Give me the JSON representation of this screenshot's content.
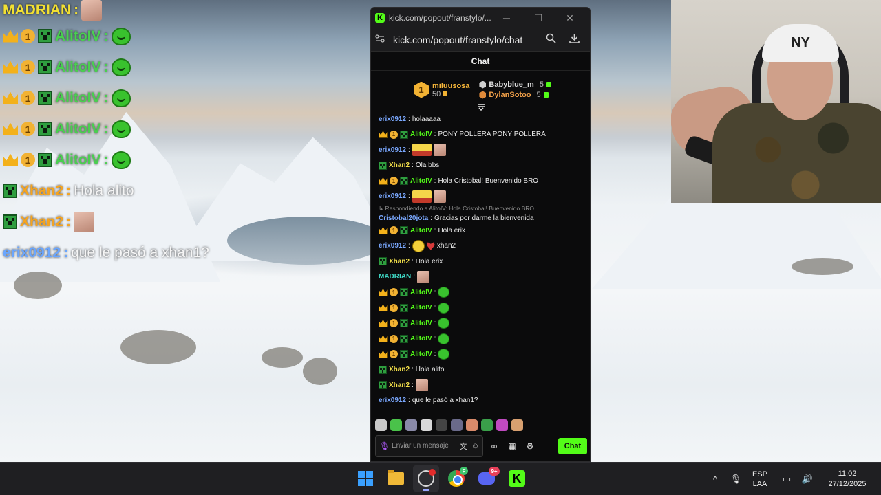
{
  "overlay": {
    "rows": [
      {
        "kind": "face",
        "name": "MADRIAN",
        "sep": ":",
        "name_color": "yellow",
        "text": ""
      },
      {
        "kind": "blob",
        "name": "AlitoIV",
        "sep": ":",
        "name_color": "green",
        "text": ""
      },
      {
        "kind": "blob",
        "name": "AlitoIV",
        "sep": ":",
        "name_color": "green",
        "text": ""
      },
      {
        "kind": "blob",
        "name": "AlitoIV",
        "sep": ":",
        "name_color": "green",
        "text": ""
      },
      {
        "kind": "blob",
        "name": "AlitoIV",
        "sep": ":",
        "name_color": "green",
        "text": ""
      },
      {
        "kind": "blob",
        "name": "AlitoIV",
        "sep": ":",
        "name_color": "green",
        "text": ""
      },
      {
        "kind": "text",
        "name": "Xhan2",
        "sep": ":",
        "name_color": "orange",
        "text": "Hola alito"
      },
      {
        "kind": "face",
        "name": "Xhan2",
        "sep": ":",
        "name_color": "orange",
        "text": ""
      },
      {
        "kind": "text",
        "name": "erix0912",
        "sep": ":",
        "name_color": "blue",
        "text": "que le pasó a xhan1?"
      }
    ]
  },
  "webcam": {
    "cap_text": "NY"
  },
  "browser": {
    "tab_title": "kick.com/popout/franstylo/...",
    "url": "kick.com/popout/franstylo/chat",
    "favicon_letter": "K",
    "min_glyph": "─",
    "max_glyph": "☐",
    "close_glyph": "✕"
  },
  "chat": {
    "header": "Chat",
    "top_gifter": {
      "rank": "1",
      "name": "miluusosa",
      "count": "50"
    },
    "gifters": [
      {
        "name": "Babyblue_m",
        "count": "5",
        "color": "#d9d9d9"
      },
      {
        "name": "DylanSotoo",
        "count": "5",
        "color": "#f6a34a"
      }
    ],
    "messages": [
      {
        "user": "erix0912",
        "color": "blue",
        "badges": [],
        "text": "holaaaaa",
        "emotes": []
      },
      {
        "user": "AlitoIV",
        "color": "green",
        "badges": [
          "crown",
          "coin",
          "creeper"
        ],
        "text": "PONY POLLERA PONY POLLERA",
        "emotes": []
      },
      {
        "user": "erix0912",
        "color": "blue",
        "badges": [],
        "text": "",
        "emotes": [
          "sign",
          "face"
        ]
      },
      {
        "user": "Xhan2",
        "color": "yellow",
        "badges": [
          "creeper"
        ],
        "text": "Ola bbs",
        "emotes": []
      },
      {
        "user": "AlitoIV",
        "color": "green",
        "badges": [
          "crown",
          "coin",
          "creeper"
        ],
        "text": "Hola Cristobal! Buenvenido BRO",
        "emotes": []
      },
      {
        "user": "erix0912",
        "color": "blue",
        "badges": [],
        "text": "",
        "emotes": [
          "sign",
          "face"
        ]
      },
      {
        "user": "Cristobal20jota",
        "color": "blue",
        "badges": [],
        "text": "Gracias por darme la bienvenida",
        "emotes": [],
        "reply": "↳ Respondiendo a AlitoIV: Hola Cristobal! Buenvenido BRO"
      },
      {
        "user": "AlitoIV",
        "color": "green",
        "badges": [
          "crown",
          "coin",
          "creeper"
        ],
        "text": "Hola erix",
        "emotes": []
      },
      {
        "user": "erix0912",
        "color": "blue",
        "badges": [],
        "text": "xhan2",
        "emotes": [
          "smiley",
          "heart"
        ]
      },
      {
        "user": "Xhan2",
        "color": "yellow",
        "badges": [
          "creeper"
        ],
        "text": "Hola erix",
        "emotes": []
      },
      {
        "user": "MADRIAN",
        "color": "teal",
        "badges": [],
        "text": "",
        "emotes": [
          "face"
        ]
      },
      {
        "user": "AlitoIV",
        "color": "green",
        "badges": [
          "crown",
          "coin",
          "creeper"
        ],
        "text": "",
        "emotes": [
          "blob"
        ]
      },
      {
        "user": "AlitoIV",
        "color": "green",
        "badges": [
          "crown",
          "coin",
          "creeper"
        ],
        "text": "",
        "emotes": [
          "blob"
        ]
      },
      {
        "user": "AlitoIV",
        "color": "green",
        "badges": [
          "crown",
          "coin",
          "creeper"
        ],
        "text": "",
        "emotes": [
          "blob"
        ]
      },
      {
        "user": "AlitoIV",
        "color": "green",
        "badges": [
          "crown",
          "coin",
          "creeper"
        ],
        "text": "",
        "emotes": [
          "blob"
        ]
      },
      {
        "user": "AlitoIV",
        "color": "green",
        "badges": [
          "crown",
          "coin",
          "creeper"
        ],
        "text": "",
        "emotes": [
          "blob"
        ]
      },
      {
        "user": "Xhan2",
        "color": "yellow",
        "badges": [
          "creeper"
        ],
        "text": "Hola alito",
        "emotes": []
      },
      {
        "user": "Xhan2",
        "color": "yellow",
        "badges": [
          "creeper"
        ],
        "text": "",
        "emotes": [
          "face"
        ]
      },
      {
        "user": "erix0912",
        "color": "blue",
        "badges": [],
        "text": "que le pasó a xhan1?",
        "emotes": []
      }
    ],
    "emote_strip_colors": [
      "#c9c9c9",
      "#4ac24a",
      "#8a8aa8",
      "#d8d8d8",
      "#444444",
      "#6a6a8a",
      "#d98a6a",
      "#3aa04a",
      "#c04ac0",
      "#d8a070"
    ],
    "compose": {
      "placeholder": "Enviar un mensaje",
      "send_label": "Chat",
      "mic_glyph": "🎙",
      "translate_glyph": "文",
      "emoji_glyph": "☺",
      "points_glyph": "∞",
      "store_glyph": "▦",
      "settings_glyph": "⚙"
    }
  },
  "taskbar": {
    "chrome_profile": "F",
    "discord_badge": "9+",
    "kick_letter": "K",
    "chevron_glyph": "^",
    "mic_glyph": "🎙",
    "lang_line1": "ESP",
    "lang_line2": "LAA",
    "network_glyph": "▭",
    "volume_glyph": "🔊",
    "time": "11:02",
    "date": "27/12/2025"
  },
  "colors": {
    "kick_green": "#53fc18",
    "name_blue": "#7aa8ff",
    "name_yellow": "#f7e34b",
    "name_teal": "#3fd8c5",
    "badge_gold": "#f2b233"
  }
}
